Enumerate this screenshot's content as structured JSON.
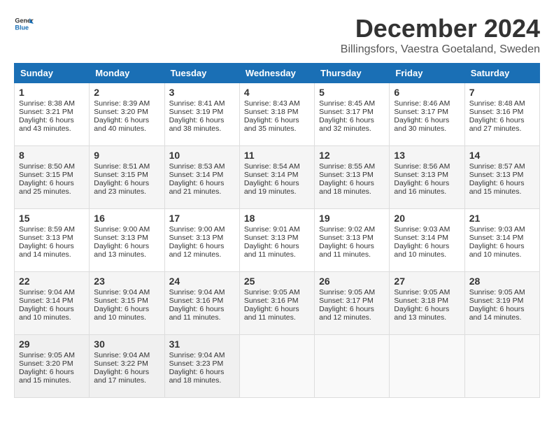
{
  "header": {
    "logo_line1": "General",
    "logo_line2": "Blue",
    "title": "December 2024",
    "subtitle": "Billingsfors, Vaestra Goetaland, Sweden"
  },
  "weekdays": [
    "Sunday",
    "Monday",
    "Tuesday",
    "Wednesday",
    "Thursday",
    "Friday",
    "Saturday"
  ],
  "weeks": [
    [
      {
        "day": "1",
        "sunrise": "8:38 AM",
        "sunset": "3:21 PM",
        "daylight": "6 hours and 43 minutes."
      },
      {
        "day": "2",
        "sunrise": "8:39 AM",
        "sunset": "3:20 PM",
        "daylight": "6 hours and 40 minutes."
      },
      {
        "day": "3",
        "sunrise": "8:41 AM",
        "sunset": "3:19 PM",
        "daylight": "6 hours and 38 minutes."
      },
      {
        "day": "4",
        "sunrise": "8:43 AM",
        "sunset": "3:18 PM",
        "daylight": "6 hours and 35 minutes."
      },
      {
        "day": "5",
        "sunrise": "8:45 AM",
        "sunset": "3:17 PM",
        "daylight": "6 hours and 32 minutes."
      },
      {
        "day": "6",
        "sunrise": "8:46 AM",
        "sunset": "3:17 PM",
        "daylight": "6 hours and 30 minutes."
      },
      {
        "day": "7",
        "sunrise": "8:48 AM",
        "sunset": "3:16 PM",
        "daylight": "6 hours and 27 minutes."
      }
    ],
    [
      {
        "day": "8",
        "sunrise": "8:50 AM",
        "sunset": "3:15 PM",
        "daylight": "6 hours and 25 minutes."
      },
      {
        "day": "9",
        "sunrise": "8:51 AM",
        "sunset": "3:15 PM",
        "daylight": "6 hours and 23 minutes."
      },
      {
        "day": "10",
        "sunrise": "8:53 AM",
        "sunset": "3:14 PM",
        "daylight": "6 hours and 21 minutes."
      },
      {
        "day": "11",
        "sunrise": "8:54 AM",
        "sunset": "3:14 PM",
        "daylight": "6 hours and 19 minutes."
      },
      {
        "day": "12",
        "sunrise": "8:55 AM",
        "sunset": "3:13 PM",
        "daylight": "6 hours and 18 minutes."
      },
      {
        "day": "13",
        "sunrise": "8:56 AM",
        "sunset": "3:13 PM",
        "daylight": "6 hours and 16 minutes."
      },
      {
        "day": "14",
        "sunrise": "8:57 AM",
        "sunset": "3:13 PM",
        "daylight": "6 hours and 15 minutes."
      }
    ],
    [
      {
        "day": "15",
        "sunrise": "8:59 AM",
        "sunset": "3:13 PM",
        "daylight": "6 hours and 14 minutes."
      },
      {
        "day": "16",
        "sunrise": "9:00 AM",
        "sunset": "3:13 PM",
        "daylight": "6 hours and 13 minutes."
      },
      {
        "day": "17",
        "sunrise": "9:00 AM",
        "sunset": "3:13 PM",
        "daylight": "6 hours and 12 minutes."
      },
      {
        "day": "18",
        "sunrise": "9:01 AM",
        "sunset": "3:13 PM",
        "daylight": "6 hours and 11 minutes."
      },
      {
        "day": "19",
        "sunrise": "9:02 AM",
        "sunset": "3:13 PM",
        "daylight": "6 hours and 11 minutes."
      },
      {
        "day": "20",
        "sunrise": "9:03 AM",
        "sunset": "3:14 PM",
        "daylight": "6 hours and 10 minutes."
      },
      {
        "day": "21",
        "sunrise": "9:03 AM",
        "sunset": "3:14 PM",
        "daylight": "6 hours and 10 minutes."
      }
    ],
    [
      {
        "day": "22",
        "sunrise": "9:04 AM",
        "sunset": "3:14 PM",
        "daylight": "6 hours and 10 minutes."
      },
      {
        "day": "23",
        "sunrise": "9:04 AM",
        "sunset": "3:15 PM",
        "daylight": "6 hours and 10 minutes."
      },
      {
        "day": "24",
        "sunrise": "9:04 AM",
        "sunset": "3:16 PM",
        "daylight": "6 hours and 11 minutes."
      },
      {
        "day": "25",
        "sunrise": "9:05 AM",
        "sunset": "3:16 PM",
        "daylight": "6 hours and 11 minutes."
      },
      {
        "day": "26",
        "sunrise": "9:05 AM",
        "sunset": "3:17 PM",
        "daylight": "6 hours and 12 minutes."
      },
      {
        "day": "27",
        "sunrise": "9:05 AM",
        "sunset": "3:18 PM",
        "daylight": "6 hours and 13 minutes."
      },
      {
        "day": "28",
        "sunrise": "9:05 AM",
        "sunset": "3:19 PM",
        "daylight": "6 hours and 14 minutes."
      }
    ],
    [
      {
        "day": "29",
        "sunrise": "9:05 AM",
        "sunset": "3:20 PM",
        "daylight": "6 hours and 15 minutes."
      },
      {
        "day": "30",
        "sunrise": "9:04 AM",
        "sunset": "3:22 PM",
        "daylight": "6 hours and 17 minutes."
      },
      {
        "day": "31",
        "sunrise": "9:04 AM",
        "sunset": "3:23 PM",
        "daylight": "6 hours and 18 minutes."
      },
      null,
      null,
      null,
      null
    ]
  ],
  "labels": {
    "sunrise": "Sunrise:",
    "sunset": "Sunset:",
    "daylight": "Daylight:"
  }
}
